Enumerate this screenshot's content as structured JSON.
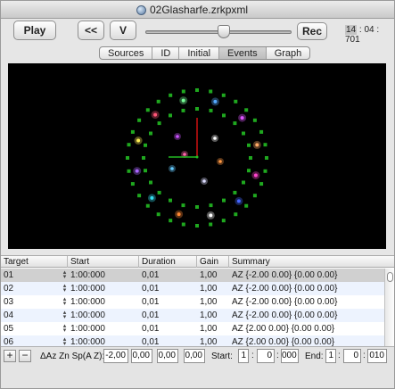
{
  "window": {
    "title": "02Glasharfe.zrkpxml"
  },
  "toolbar": {
    "play_label": "Play",
    "back_label": "<<",
    "v_label": "V",
    "rec_label": "Rec",
    "slider_value": 0.55,
    "time_hours": "14",
    "time_minutes": "04",
    "time_ms": "701"
  },
  "tabs": [
    {
      "label": "Sources"
    },
    {
      "label": "ID"
    },
    {
      "label": "Initial"
    },
    {
      "label": "Events",
      "active": true
    },
    {
      "label": "Graph"
    }
  ],
  "table": {
    "columns": [
      "Target",
      "Start",
      "Duration",
      "Gain",
      "Summary"
    ],
    "rows": [
      {
        "target": "01",
        "start": "1:00:000",
        "duration": "0,01",
        "gain": "1,00",
        "summary": "AZ {-2.00 0.00} {0.00 0.00}"
      },
      {
        "target": "02",
        "start": "1:00:000",
        "duration": "0,01",
        "gain": "1,00",
        "summary": "AZ {-2.00 0.00} {0.00 0.00}"
      },
      {
        "target": "03",
        "start": "1:00:000",
        "duration": "0,01",
        "gain": "1,00",
        "summary": "AZ {-2.00 0.00} {0.00 0.00}"
      },
      {
        "target": "04",
        "start": "1:00:000",
        "duration": "0,01",
        "gain": "1,00",
        "summary": "AZ {-2.00 0.00} {0.00 0.00}"
      },
      {
        "target": "05",
        "start": "1:00:000",
        "duration": "0,01",
        "gain": "1,00",
        "summary": "AZ {2.00 0.00} {0.00 0.00}"
      },
      {
        "target": "06",
        "start": "1:00:000",
        "duration": "0,01",
        "gain": "1,00",
        "summary": "AZ {2.00 0.00} {0.00 0.00}"
      }
    ]
  },
  "bottom": {
    "add_label": "+",
    "remove_label": "−",
    "param_label": "ΔAz Zn Sp(A Z):",
    "param_values": [
      "-2,00",
      "0,00",
      "0,00",
      "0,00"
    ],
    "start_label": "Start:",
    "start_values": [
      "1",
      "0",
      "000"
    ],
    "end_label": "End:",
    "end_values": [
      "1",
      "0",
      "010"
    ]
  },
  "colors": {
    "speaker_green": "#1fa81f",
    "axis_red": "#cc1111",
    "axis_green": "#22bb22"
  }
}
